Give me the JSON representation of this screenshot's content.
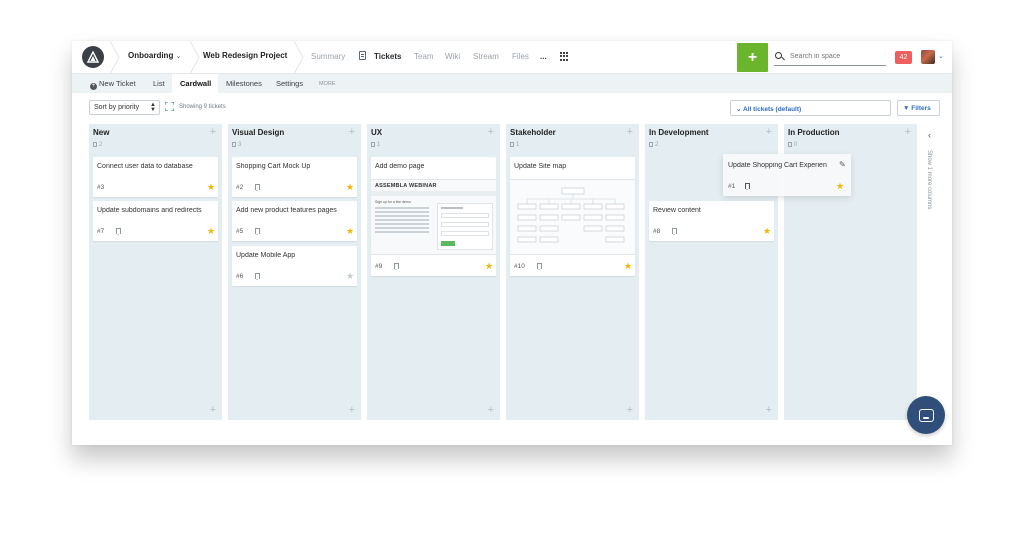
{
  "breadcrumb": {
    "space": "Onboarding",
    "project": "Web Redesign Project"
  },
  "nav": {
    "links": [
      "Summary",
      "Tickets",
      "Team",
      "Wiki",
      "Stream",
      "Files",
      "..."
    ],
    "active": "Tickets"
  },
  "header": {
    "add_label": "+",
    "search_placeholder": "Search in space",
    "notification_count": "42",
    "accent_color": "#6ab52b",
    "notification_color": "#ef5f5f"
  },
  "subnav": {
    "new_ticket": "New Ticket",
    "list": "List",
    "cardwall": "Cardwall",
    "milestones": "Milestones",
    "settings": "Settings",
    "more": "MORE"
  },
  "toolbar": {
    "sort_value": "Sort by priority",
    "showing": "Showing 9 tickets",
    "all_tickets": "All tickets (default)",
    "filters": "Filters"
  },
  "columns": [
    {
      "title": "New",
      "count": "2",
      "cards": [
        {
          "title": "Connect user data to database",
          "num": "#3",
          "starred": true
        },
        {
          "title": "Update subdomains and redirects",
          "num": "#7",
          "starred": true
        }
      ]
    },
    {
      "title": "Visual Design",
      "count": "3",
      "cards": [
        {
          "title": "Shopping Cart Mock Up",
          "num": "#2",
          "starred": true
        },
        {
          "title": "Add new product features pages",
          "num": "#5",
          "starred": true
        },
        {
          "title": "Update Mobile App",
          "num": "#6",
          "starred": false
        }
      ]
    },
    {
      "title": "UX",
      "count": "1",
      "cards": [
        {
          "title": "Add demo page",
          "num": "#9",
          "starred": true,
          "thumb_title": "ASSEMBLA WEBINAR",
          "thumb_sub": "Sign up for a live demo"
        }
      ]
    },
    {
      "title": "Stakeholder",
      "count": "1",
      "cards": [
        {
          "title": "Update Site map",
          "num": "#10",
          "starred": true
        }
      ]
    },
    {
      "title": "In Development",
      "count": "2",
      "cards": [
        {
          "title": "Update Shopping Cart Experien",
          "num": "#1",
          "starred": true
        },
        {
          "title": "Review content",
          "num": "#8",
          "starred": true
        }
      ]
    },
    {
      "title": "In Production",
      "count": "0",
      "cards": []
    }
  ],
  "collapsed_panel": {
    "text": "Show 1 more columns"
  },
  "icons": {
    "logo": "assembla-logo-icon",
    "search": "search-icon",
    "star": "star-icon",
    "bookmark": "bookmark-icon",
    "chat": "chat-icon"
  }
}
